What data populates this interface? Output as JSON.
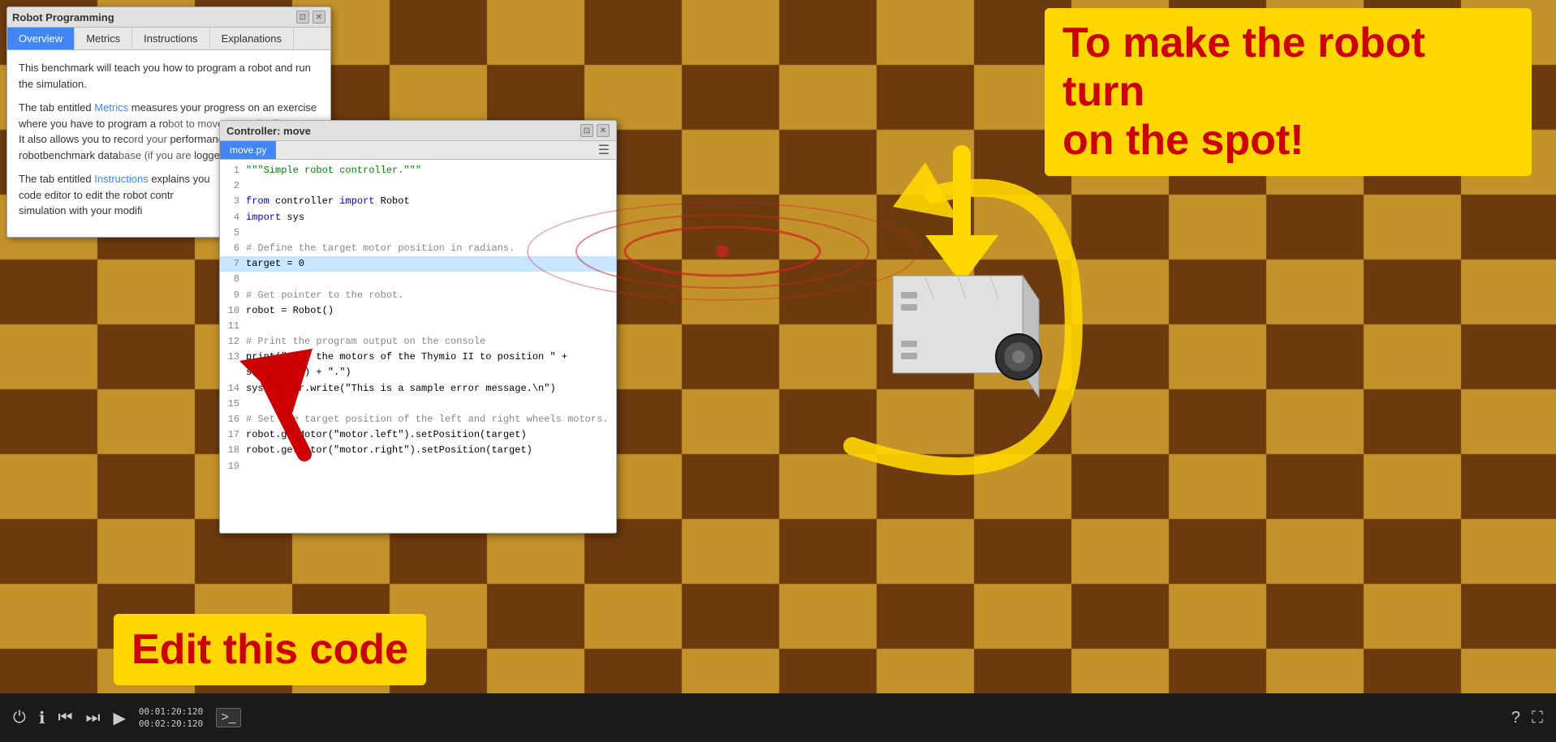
{
  "scene": {
    "background_color": "#8B6914"
  },
  "robot_panel": {
    "title": "Robot Programming",
    "tabs": [
      "Overview",
      "Metrics",
      "Instructions",
      "Explanations"
    ],
    "active_tab": "Overview",
    "content_paragraphs": [
      "This benchmark will teach you how to program a robot and run the simulation.",
      "The tab entitled Metrics measures your progress on an exercise where you have to program a robot to move a certain distance. It also allows you to record your performance in the robotbenchmark database (if you are logged-in).",
      "The tab entitled Instructions explains you how to use the source code editor to edit the robot controller, to save it and run the simulation with your modified controller."
    ],
    "controls": [
      "⊡",
      "✕"
    ]
  },
  "controller_panel": {
    "title": "Controller: move",
    "active_tab": "move.py",
    "controls": [
      "⊡",
      "✕"
    ],
    "code_lines": [
      {
        "num": 1,
        "text": "\"\"\"Simple robot controller.\"\"\"",
        "type": "string"
      },
      {
        "num": 2,
        "text": "",
        "type": "normal"
      },
      {
        "num": 3,
        "text": "from controller import Robot",
        "type": "import"
      },
      {
        "num": 4,
        "text": "import sys",
        "type": "import"
      },
      {
        "num": 5,
        "text": "",
        "type": "normal"
      },
      {
        "num": 6,
        "text": "# Define the target motor position in radians.",
        "type": "comment"
      },
      {
        "num": 7,
        "text": "target = 0",
        "type": "highlight"
      },
      {
        "num": 8,
        "text": "",
        "type": "normal"
      },
      {
        "num": 9,
        "text": "# Get pointer to the robot.",
        "type": "comment"
      },
      {
        "num": 10,
        "text": "robot = Robot()",
        "type": "normal"
      },
      {
        "num": 11,
        "text": "",
        "type": "normal"
      },
      {
        "num": 12,
        "text": "# Print the program output on the console",
        "type": "comment"
      },
      {
        "num": 13,
        "text": "print(\"Move the motors of the Thymio II to position \" + str(target) + \".\")",
        "type": "normal"
      },
      {
        "num": 14,
        "text": "sys.stderr.write(\"This is a sample error message.\\n\")",
        "type": "normal"
      },
      {
        "num": 15,
        "text": "",
        "type": "normal"
      },
      {
        "num": 16,
        "text": "# Set the target position of the left and right wheels motors.",
        "type": "comment"
      },
      {
        "num": 17,
        "text": "robot.getMotor(\"motor.left\").setPosition(target)",
        "type": "normal"
      },
      {
        "num": 18,
        "text": "robot.getMotor(\"motor.right\").setPosition(target)",
        "type": "normal"
      },
      {
        "num": 19,
        "text": "",
        "type": "normal"
      }
    ]
  },
  "annotations": {
    "turn_label": "To make the robot turn\non the spot!",
    "edit_label": "Edit this code"
  },
  "bottom_bar": {
    "time1": "00:01:20:120",
    "time2": "00:02:20:120",
    "icons": [
      "power",
      "info",
      "skip-back",
      "skip-forward",
      "play",
      "terminal",
      "question",
      "fullscreen"
    ]
  }
}
